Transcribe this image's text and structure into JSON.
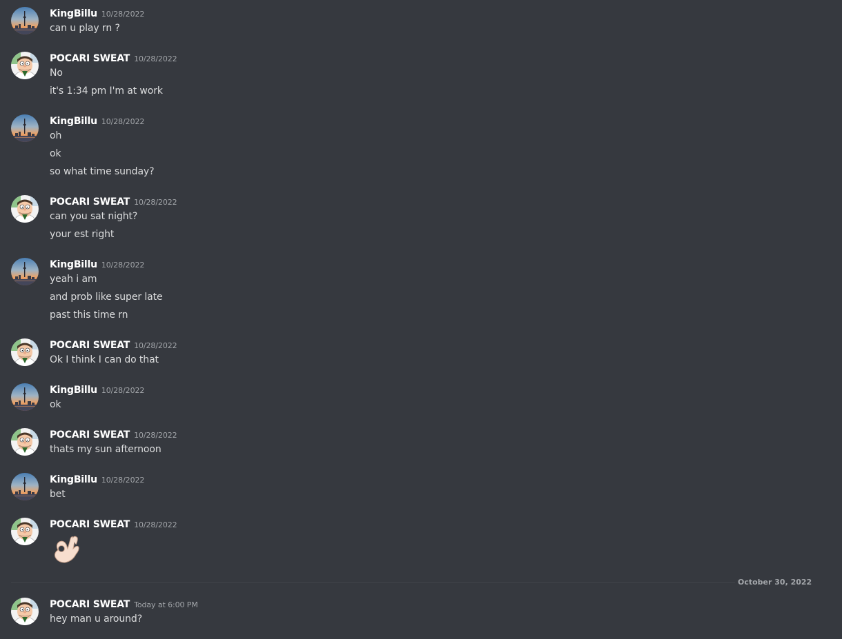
{
  "users": {
    "kingbillu": {
      "name": "KingBillu",
      "avatar_icon": "sunset-city-avatar-icon"
    },
    "pocari": {
      "name": "POCARI SWEAT",
      "avatar_icon": "cartoon-man-avatar-icon"
    }
  },
  "messages": [
    {
      "author": "KingBillu",
      "timestamp": "10/28/2022",
      "lines": [
        "can u play rn ?"
      ]
    },
    {
      "author": "POCARI SWEAT",
      "timestamp": "10/28/2022",
      "lines": [
        "No",
        "it's 1:34 pm I'm at work"
      ]
    },
    {
      "author": "KingBillu",
      "timestamp": "10/28/2022",
      "lines": [
        "oh",
        "ok",
        "so what time sunday?"
      ]
    },
    {
      "author": "POCARI SWEAT",
      "timestamp": "10/28/2022",
      "lines": [
        "can you sat night?",
        "your est right"
      ]
    },
    {
      "author": "KingBillu",
      "timestamp": "10/28/2022",
      "lines": [
        "yeah i am",
        "and prob like super late",
        "past this time rn"
      ]
    },
    {
      "author": "POCARI SWEAT",
      "timestamp": "10/28/2022",
      "lines": [
        "Ok I think I can do that"
      ]
    },
    {
      "author": "KingBillu",
      "timestamp": "10/28/2022",
      "lines": [
        "ok"
      ]
    },
    {
      "author": "POCARI SWEAT",
      "timestamp": "10/28/2022",
      "lines": [
        "thats my sun afternoon"
      ]
    },
    {
      "author": "KingBillu",
      "timestamp": "10/28/2022",
      "lines": [
        "bet"
      ]
    },
    {
      "author": "POCARI SWEAT",
      "timestamp": "10/28/2022",
      "emoji": "ok-hand-emoji-icon"
    },
    {
      "author": "POCARI SWEAT",
      "timestamp": "Today at 6:00 PM",
      "lines": [
        "hey man u around?"
      ]
    }
  ],
  "date_divider": {
    "label": "October 30, 2022"
  },
  "colors": {
    "background": "#36393f",
    "username": "#ffffff",
    "message_text": "#dcddde",
    "timestamp": "#a3a6aa",
    "divider": "#42454a"
  }
}
